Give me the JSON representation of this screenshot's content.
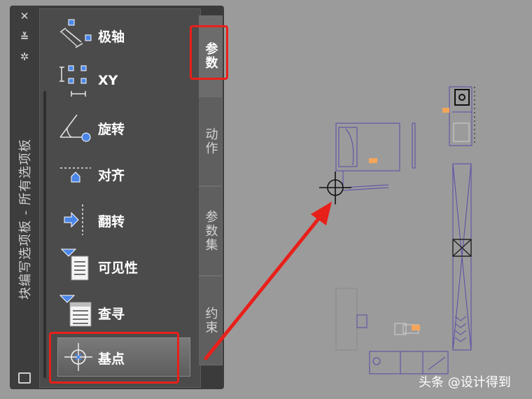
{
  "palette": {
    "title": "块编写选项板 - 所有选项板",
    "title_buttons": [
      "✕",
      "≚",
      "✲"
    ],
    "tools": [
      {
        "icon": "polar-parameter-icon",
        "label": "极轴"
      },
      {
        "icon": "xy-parameter-icon",
        "label": "XY"
      },
      {
        "icon": "rotation-parameter-icon",
        "label": "旋转"
      },
      {
        "icon": "alignment-parameter-icon",
        "label": "对齐"
      },
      {
        "icon": "flip-parameter-icon",
        "label": "翻转"
      },
      {
        "icon": "visibility-parameter-icon",
        "label": "可见性"
      },
      {
        "icon": "lookup-parameter-icon",
        "label": "查寻"
      },
      {
        "icon": "base-point-parameter-icon",
        "label": "基点"
      }
    ],
    "tabs": [
      {
        "label": "参数",
        "active": true
      },
      {
        "label": "动作",
        "active": false
      },
      {
        "label": "参数集",
        "active": false
      },
      {
        "label": "约束",
        "active": false
      }
    ]
  },
  "watermark": "头条 @设计得到",
  "colors": {
    "highlight": "#e8201a",
    "drawing_lines": "#5b4aa8",
    "grip_orange": "#f5a55a",
    "canvas": "#9b9b9b"
  }
}
